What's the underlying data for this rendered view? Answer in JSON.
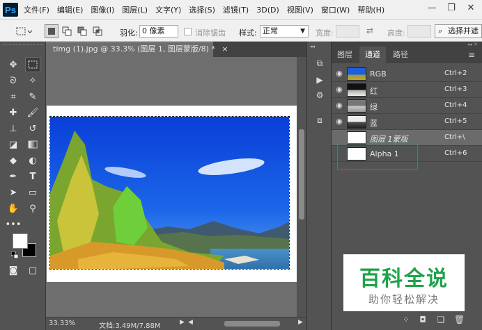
{
  "app": {
    "logo": "Ps"
  },
  "menu": [
    "文件(F)",
    "编辑(E)",
    "图像(I)",
    "图层(L)",
    "文字(Y)",
    "选择(S)",
    "滤镜(T)",
    "3D(D)",
    "视图(V)",
    "窗口(W)",
    "帮助(H)"
  ],
  "window_controls": {
    "minimize": "—",
    "restore": "❐",
    "close": "✕"
  },
  "options": {
    "feather_label": "羽化:",
    "feather_value": "0 像素",
    "antialias_label": "消除锯齿",
    "style_label": "样式:",
    "style_value": "正常",
    "width_label": "宽度:",
    "height_label": "高度:",
    "select_mask_button": "选择并遮"
  },
  "document": {
    "tab_title": "timg (1).jpg @ 33.3% (图层 1, 图层蒙版/8) *",
    "tab_close": "×",
    "zoom": "33.33%",
    "doc_size": "文档:3.49M/7.88M"
  },
  "panel": {
    "tabs": [
      "图层",
      "通道",
      "路径"
    ],
    "active_tab": "通道",
    "channels": [
      {
        "name": "RGB",
        "shortcut": "Ctrl+2",
        "visible": true,
        "thumb": "rgb"
      },
      {
        "name": "红",
        "shortcut": "Ctrl+3",
        "visible": true,
        "thumb": "gray1"
      },
      {
        "name": "绿",
        "shortcut": "Ctrl+4",
        "visible": true,
        "thumb": "gray2"
      },
      {
        "name": "蓝",
        "shortcut": "Ctrl+5",
        "visible": true,
        "thumb": "gray3"
      },
      {
        "name": "图层 1蒙版",
        "shortcut": "Ctrl+\\",
        "visible": false,
        "thumb": "white"
      },
      {
        "name": "Alpha 1",
        "shortcut": "Ctrl+6",
        "visible": false,
        "thumb": "white"
      }
    ]
  },
  "watermark": {
    "title": "百科全说",
    "subtitle": "助你轻松解决"
  },
  "colors": {
    "accent_red": "#e23b3b",
    "watermark_green": "#1fa24a",
    "ps_blue": "#31a8ff"
  }
}
